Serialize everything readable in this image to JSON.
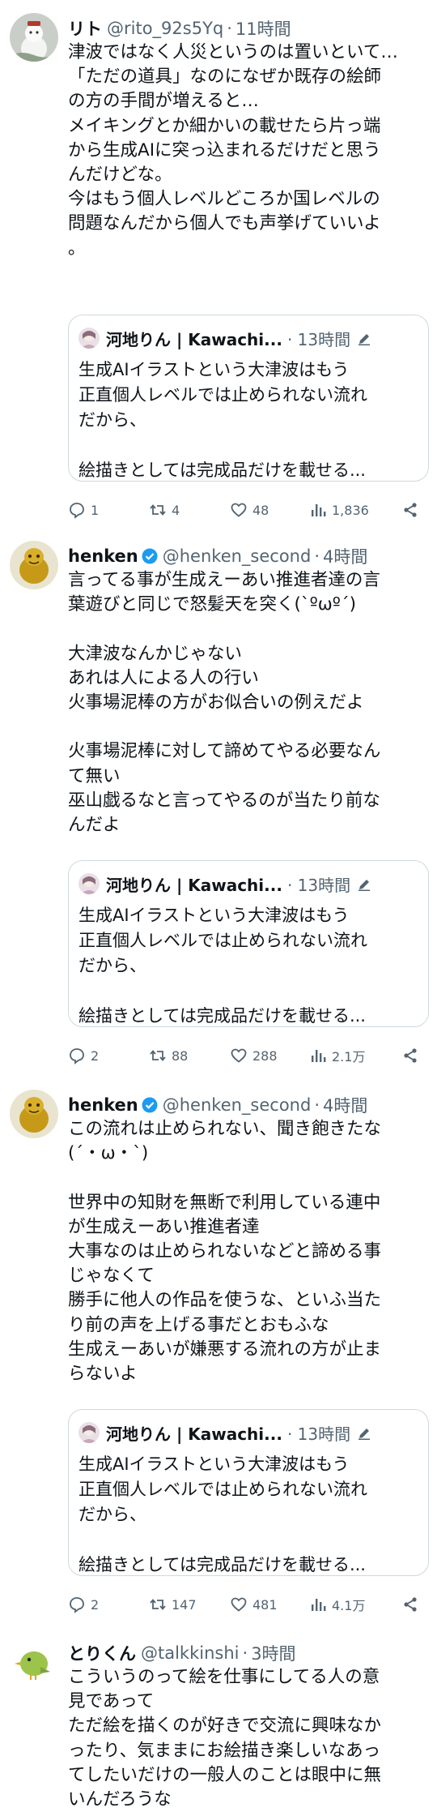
{
  "tweets": [
    {
      "name": "リト",
      "handle": "@rito_92s5Yq",
      "time": "11時間",
      "verified": false,
      "lines": [
        "津波ではなく人災というのは置いといて…",
        "「ただの道具」なのになぜか既存の絵師",
        "の方の手間が増えると…",
        "メイキングとか細かいの載せたら片っ端",
        "から生成AIに突っ込まれるだけだと思う",
        "んだけどな。",
        "今はもう個人レベルどころか国レベルの",
        "問題なんだから個人でも声挙げていいよ",
        "。"
      ],
      "quote": {
        "name": "河地りん | Kawachi...",
        "time": "13時間",
        "lines": [
          "生成AIイラストという大津波はもう",
          "正直個人レベルでは止められない流れ",
          "だから、",
          "",
          "絵描きとしては完成品だけを載せる..."
        ]
      },
      "actions": {
        "reply": "1",
        "retweet": "4",
        "like": "48",
        "views": "1,836"
      }
    },
    {
      "name": "henken",
      "handle": "@henken_second",
      "time": "4時間",
      "verified": true,
      "lines": [
        "言ってる事が生成えーあい推進者達の言",
        "葉遊びと同じで怒髪天を突く(`ºωº´)",
        "",
        "大津波なんかじゃない",
        "あれは人による人の行い",
        "火事場泥棒の方がお似合いの例えだよ",
        "",
        "火事場泥棒に対して諦めてやる必要なん",
        "て無い",
        "巫山戯るなと言ってやるのが当たり前な",
        "んだよ"
      ],
      "quote": {
        "name": "河地りん | Kawachi...",
        "time": "13時間",
        "lines": [
          "生成AIイラストという大津波はもう",
          "正直個人レベルでは止められない流れ",
          "だから、",
          "",
          "絵描きとしては完成品だけを載せる..."
        ]
      },
      "actions": {
        "reply": "2",
        "retweet": "88",
        "like": "288",
        "views": "2.1万"
      }
    },
    {
      "name": "henken",
      "handle": "@henken_second",
      "time": "4時間",
      "verified": true,
      "lines": [
        "この流れは止められない、聞き飽きたな",
        "(´・ω・`)",
        "",
        "世界中の知財を無断で利用している連中",
        "が生成えーあい推進者達",
        "大事なのは止められないなどと諦める事",
        "じゃなくて",
        "勝手に他人の作品を使うな、といふ当た",
        "り前の声を上げる事だとおもふな",
        "生成えーあいが嫌悪する流れの方が止ま",
        "らないよ"
      ],
      "quote": {
        "name": "河地りん | Kawachi...",
        "time": "13時間",
        "lines": [
          "生成AIイラストという大津波はもう",
          "正直個人レベルでは止められない流れ",
          "だから、",
          "",
          "絵描きとしては完成品だけを載せる..."
        ]
      },
      "actions": {
        "reply": "2",
        "retweet": "147",
        "like": "481",
        "views": "4.1万"
      }
    },
    {
      "name": "とりくん",
      "handle": "@talkkinshi",
      "time": "3時間",
      "verified": false,
      "lines": [
        "こういうのって絵を仕事にしてる人の意",
        "見であって",
        "ただ絵を描くのが好きで交流に興味なか",
        "ったり、気ままにお絵描き楽しいなあっ",
        "てしたいだけの一般人のことは眼中に無",
        "いんだろうな"
      ]
    }
  ],
  "icons": {
    "reply": "reply-icon",
    "retweet": "retweet-icon",
    "like": "like-icon",
    "views": "views-icon",
    "share": "share-icon",
    "verified": "verified-badge-icon",
    "pen": "pen-icon"
  },
  "colors": {
    "text": "#0f1419",
    "secondary": "#536471",
    "border": "#cfd9de",
    "verified": "#1d9bf0"
  }
}
